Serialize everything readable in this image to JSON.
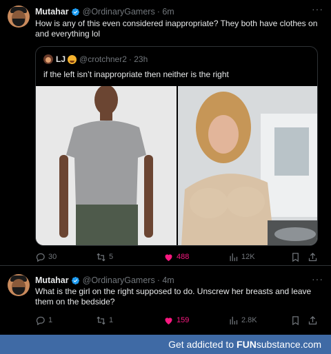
{
  "tweet1": {
    "author": "Mutahar",
    "handle": "@OrdinaryGamers",
    "time": "· 6m",
    "text": "How is any of this even considered  inappropriate? They both have clothes on and everything lol",
    "quote": {
      "author": "LJ",
      "handle": "@crotchner2",
      "time": "· 23h",
      "text": "if the left isn’t inappropriate then neither is the right"
    },
    "stats": {
      "replies": "30",
      "retweets": "5",
      "likes": "488",
      "views": "12K"
    }
  },
  "tweet2": {
    "author": "Mutahar",
    "handle": "@OrdinaryGamers",
    "time": "· 4m",
    "text": "What is the girl on the right supposed to do. Unscrew her breasts and leave them on the bedside?",
    "stats": {
      "replies": "1",
      "retweets": "1",
      "likes": "159",
      "views": "2.8K"
    }
  },
  "footer": {
    "text": "Get addicted to",
    "brand": "FUN",
    "brand2": "substance.com"
  },
  "colors": {
    "verified": "#1d9bf0",
    "like": "#f91880",
    "muted": "#71767b",
    "footer_bg": "#3f6aa5"
  }
}
